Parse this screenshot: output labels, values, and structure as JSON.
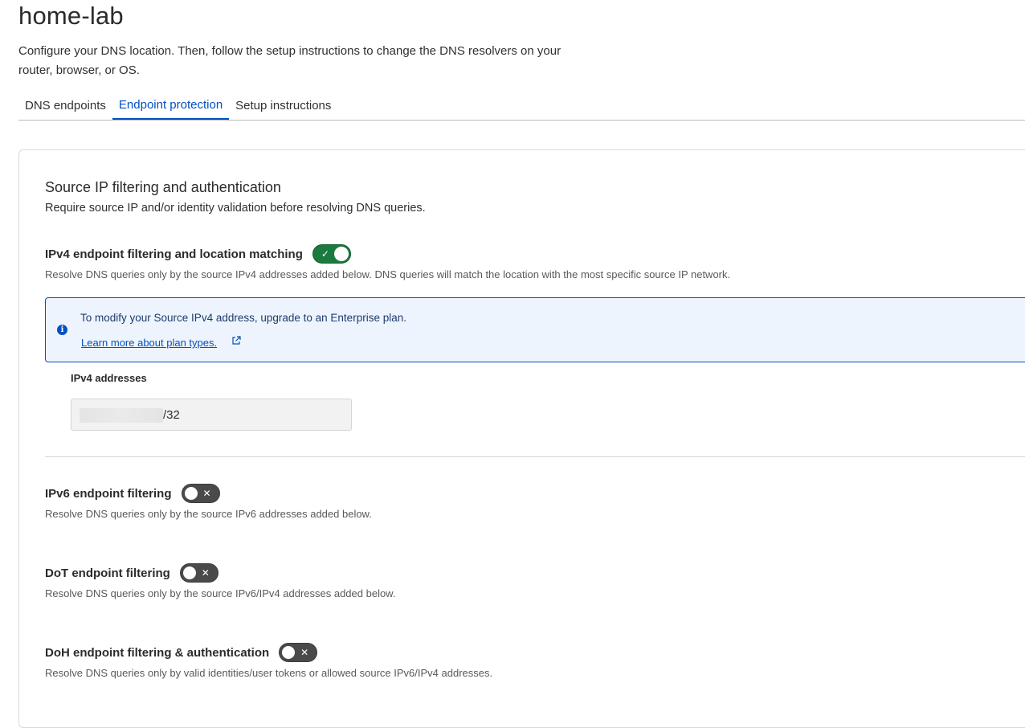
{
  "page": {
    "title": "home-lab",
    "description": "Configure your DNS location. Then, follow the setup instructions to change the DNS resolvers on your router, browser, or OS."
  },
  "tabs": [
    {
      "label": "DNS endpoints",
      "active": false
    },
    {
      "label": "Endpoint protection",
      "active": true
    },
    {
      "label": "Setup instructions",
      "active": false
    }
  ],
  "section": {
    "title": "Source IP filtering and authentication",
    "description": "Require source IP and/or identity validation before resolving DNS queries."
  },
  "settings": {
    "ipv4": {
      "label": "IPv4 endpoint filtering and location matching",
      "enabled": true,
      "description": "Resolve DNS queries only by the source IPv4 addresses added below. DNS queries will match the location with the most specific source IP network."
    },
    "ipv6": {
      "label": "IPv6 endpoint filtering",
      "enabled": false,
      "description": "Resolve DNS queries only by the source IPv6 addresses added below."
    },
    "dot": {
      "label": "DoT endpoint filtering",
      "enabled": false,
      "description": "Resolve DNS queries only by the source IPv6/IPv4 addresses added below."
    },
    "doh": {
      "label": "DoH endpoint filtering & authentication",
      "enabled": false,
      "description": "Resolve DNS queries only by valid identities/user tokens or allowed source IPv6/IPv4 addresses."
    }
  },
  "notice": {
    "text": "To modify your Source IPv4 address, upgrade to an Enterprise plan.",
    "link": "Learn more about plan types."
  },
  "ipv4_addresses": {
    "label": "IPv4 addresses",
    "suffix": "/32"
  },
  "colors": {
    "accent": "#0051c3",
    "toggle_on": "#1b7a3f",
    "toggle_off": "#4a4a4a",
    "notice_bg": "#eef4fd"
  }
}
